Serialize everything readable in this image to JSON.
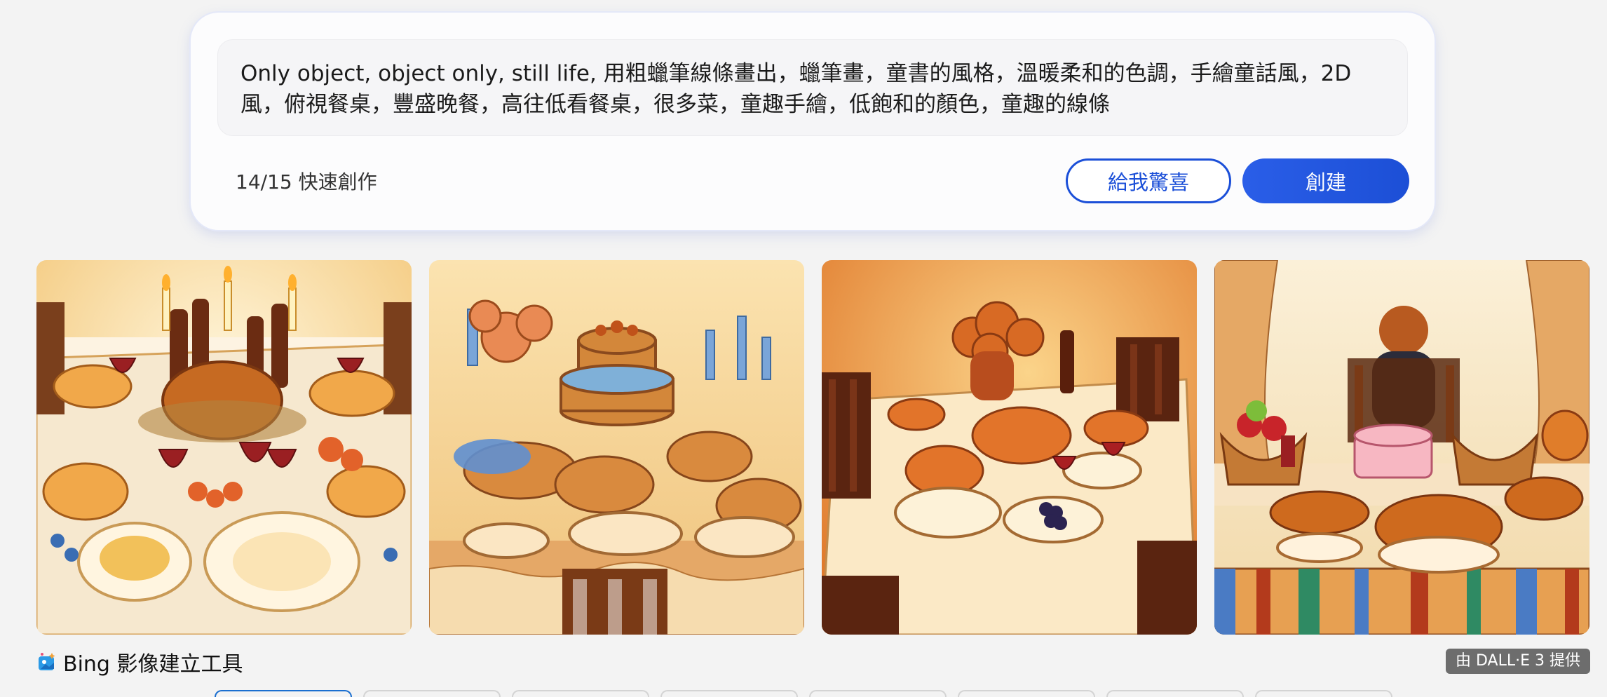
{
  "prompt": {
    "text": "Only object, object only, still life, 用粗蠟筆線條畫出，蠟筆畫，童書的風格，溫暖柔和的色調，手繪童話風，2D風，俯視餐桌，豐盛晚餐，高往低看餐桌，很多菜，童趣手繪，低飽和的顏色，童趣的線條"
  },
  "footer": {
    "counter": "14/15 快速創作",
    "surprise_label": "給我驚喜",
    "create_label": "創建"
  },
  "gallery": {
    "images": [
      {
        "icon": "feast-table-illustration-1"
      },
      {
        "icon": "feast-table-illustration-2"
      },
      {
        "icon": "feast-table-illustration-3"
      },
      {
        "icon": "feast-table-illustration-4"
      }
    ]
  },
  "brand": {
    "name": "Bing 影像建立工具",
    "icon": "bing-image-creator-icon"
  },
  "badge": {
    "text": "由 DALL·E 3 提供"
  },
  "colors": {
    "accent": "#1b4fd8",
    "card_bg": "#fcfcfd",
    "page_bg": "#f3f3f3"
  }
}
